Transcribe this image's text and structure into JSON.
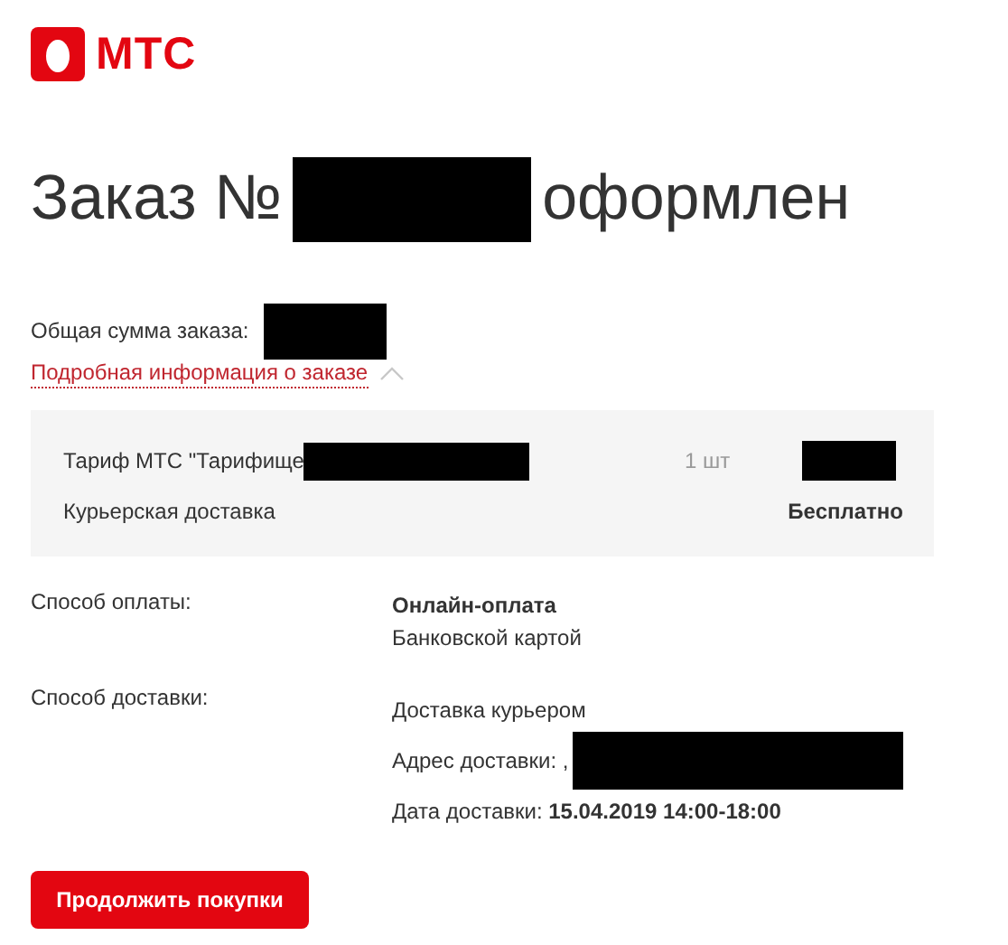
{
  "logo": {
    "text": "МТС"
  },
  "title": {
    "before": "Заказ №",
    "after": "оформлен"
  },
  "total": {
    "label": "Общая сумма заказа:"
  },
  "details_link": {
    "label": "Подробная информация о заказе",
    "expanded": true
  },
  "items": [
    {
      "name": "Тариф МТС \"Тарифище",
      "quantity": "1 шт"
    },
    {
      "name": "Курьерская доставка",
      "price": "Бесплатно"
    }
  ],
  "info": [
    {
      "label": "Способ оплаты:",
      "lines": [
        "**Онлайн-оплата**",
        "Банковской картой"
      ]
    },
    {
      "label": "Способ доставки:",
      "lines": [
        "Доставка курьером",
        "Адрес доставки: ,",
        "Дата доставки: **15.04.2019 14:00-18:00**"
      ]
    }
  ],
  "button": "Продолжить покупки"
}
